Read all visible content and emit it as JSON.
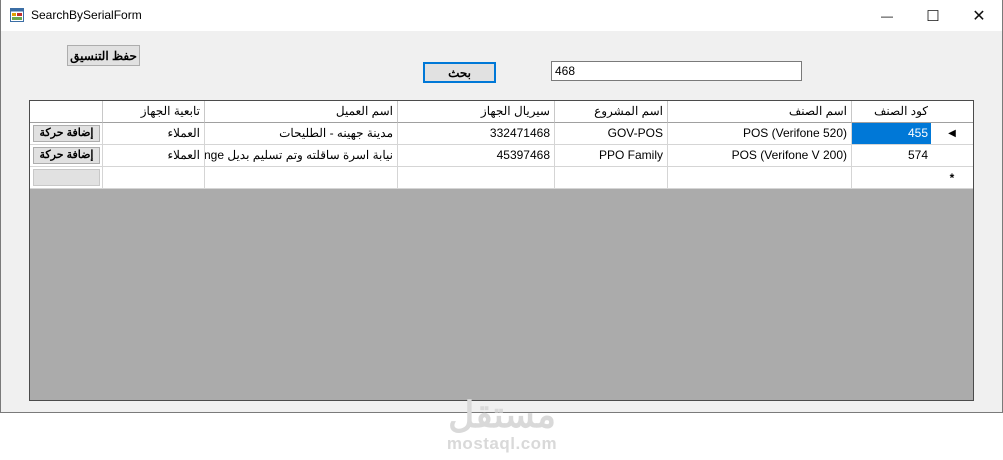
{
  "window": {
    "title": "SearchBySerialForm",
    "min": "—",
    "max": "☐",
    "close": "✕"
  },
  "toolbar": {
    "save_layout_label": "حفظ التنسيق",
    "search_label": "بحث",
    "search_value": "468"
  },
  "grid": {
    "columns": [
      "كود الصنف",
      "اسم الصنف",
      "اسم المشروع",
      "سيريال الجهاز",
      "اسم العميل",
      "تابعية الجهاز",
      ""
    ],
    "rows": [
      {
        "code": "455",
        "item": "POS (Verifone 520)",
        "project": "GOV-POS",
        "serial": "332471468",
        "client": "مدينة جهينه - الطليحات",
        "owner": "العملاء",
        "action": "إضافة حركة"
      },
      {
        "code": "574",
        "item": "POS (Verifone V 200)",
        "project": "PPO Family",
        "serial": "45397468",
        "client": "نيابة اسرة ساقلته وتم تسليم بديل Inge...",
        "owner": "العملاء",
        "action": "إضافة حركة"
      }
    ],
    "current_row_marker": "◀",
    "new_row_marker": "*"
  },
  "watermark": {
    "arabic": "مستقل",
    "latin": "mostaql.com"
  }
}
